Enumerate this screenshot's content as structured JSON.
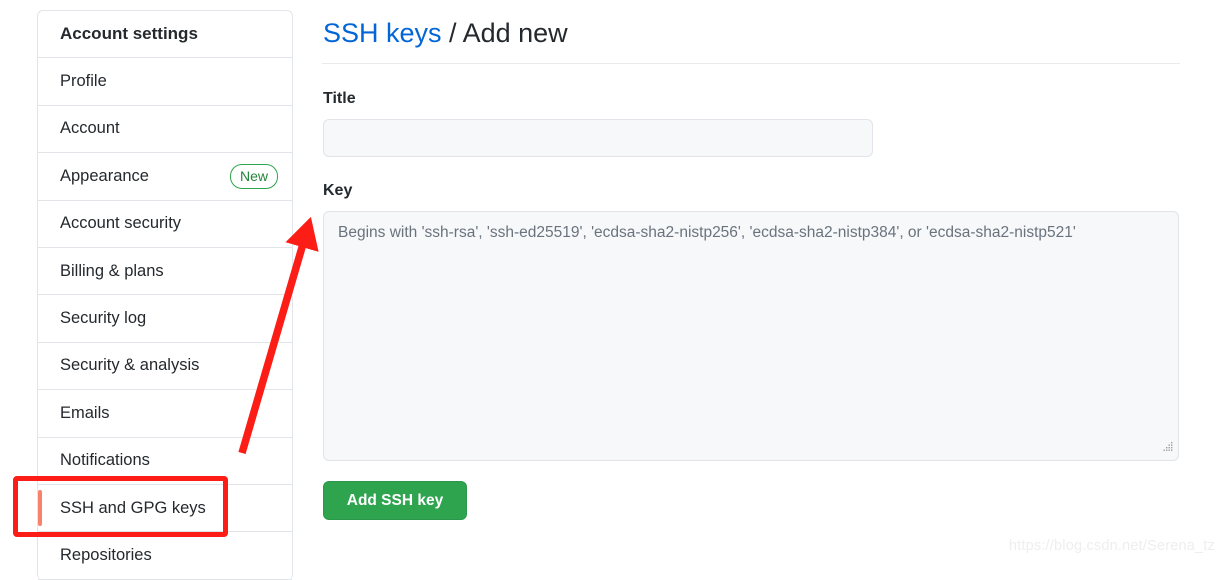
{
  "sidebar": {
    "header": "Account settings",
    "items": [
      {
        "label": "Profile",
        "badge": null,
        "selected": false
      },
      {
        "label": "Account",
        "badge": null,
        "selected": false
      },
      {
        "label": "Appearance",
        "badge": "New",
        "selected": false
      },
      {
        "label": "Account security",
        "badge": null,
        "selected": false
      },
      {
        "label": "Billing & plans",
        "badge": null,
        "selected": false
      },
      {
        "label": "Security log",
        "badge": null,
        "selected": false
      },
      {
        "label": "Security & analysis",
        "badge": null,
        "selected": false
      },
      {
        "label": "Emails",
        "badge": null,
        "selected": false
      },
      {
        "label": "Notifications",
        "badge": null,
        "selected": false
      },
      {
        "label": "SSH and GPG keys",
        "badge": null,
        "selected": true
      },
      {
        "label": "Repositories",
        "badge": null,
        "selected": false
      }
    ]
  },
  "main": {
    "heading_link": "SSH keys",
    "heading_separator": " / ",
    "heading_current": "Add new",
    "title_field": {
      "label": "Title",
      "value": "",
      "placeholder": ""
    },
    "key_field": {
      "label": "Key",
      "value": "",
      "placeholder": "Begins with 'ssh-rsa', 'ssh-ed25519', 'ecdsa-sha2-nistp256', 'ecdsa-sha2-nistp384', or 'ecdsa-sha2-nistp521'"
    },
    "submit_label": "Add SSH key"
  },
  "annotations": {
    "highlight_color": "#fb1d16",
    "selected_item_bar_color": "#f9826c"
  },
  "watermark": "https://blog.csdn.net/Serena_tz",
  "colors": {
    "link": "#0366d6",
    "text": "#24292e",
    "button_green": "#2ea44f",
    "badge_green": "#22863a",
    "field_bg": "#f6f8fa",
    "border": "#e1e4e8"
  }
}
